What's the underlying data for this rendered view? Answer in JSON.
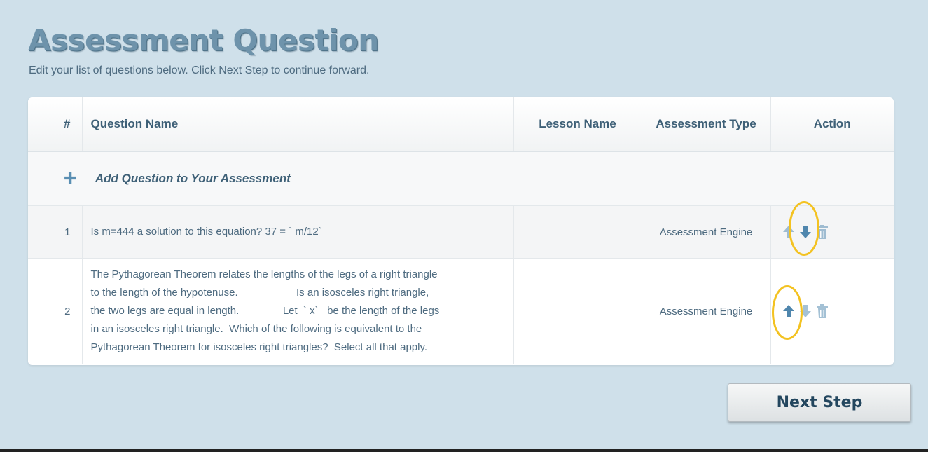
{
  "page": {
    "title": "Assessment Question",
    "subtitle": "Edit your list of questions below. Click Next Step to continue forward."
  },
  "table": {
    "headers": {
      "num": "#",
      "question_name": "Question Name",
      "lesson_name": "Lesson Name",
      "assessment_type": "Assessment Type",
      "action": "Action"
    },
    "add_row": {
      "icon": "plus-icon",
      "label": "Add Question to Your Assessment"
    },
    "rows": [
      {
        "num": "1",
        "question": "Is m=444 a solution to this equation? 37 = ` m/12`",
        "lesson": "",
        "assessment_type": "Assessment Engine",
        "actions": [
          "arrow-up-icon",
          "arrow-down-icon",
          "trash-icon"
        ]
      },
      {
        "num": "2",
        "question": "The Pythagorean Theorem relates the lengths of the legs of a right triangle\nto the length of the hypotenuse.                    Is an isosceles right triangle,\nthe two legs are equal in length.               Let  ` x`   be the length of the legs\nin an isosceles right triangle.  Which of the following is equivalent to the\nPythagorean Theorem for isosceles right triangles?  Select all that apply.",
        "lesson": "",
        "assessment_type": "Assessment Engine",
        "actions": [
          "arrow-up-icon",
          "arrow-down-icon",
          "trash-icon"
        ]
      }
    ]
  },
  "buttons": {
    "next_step": "Next Step"
  },
  "colors": {
    "background": "#cfe0ea",
    "title": "#6e93ab",
    "text": "#4e6b80",
    "header_text": "#3e6077",
    "icon_blue": "#5a8fb3",
    "highlight": "#f3c221"
  }
}
